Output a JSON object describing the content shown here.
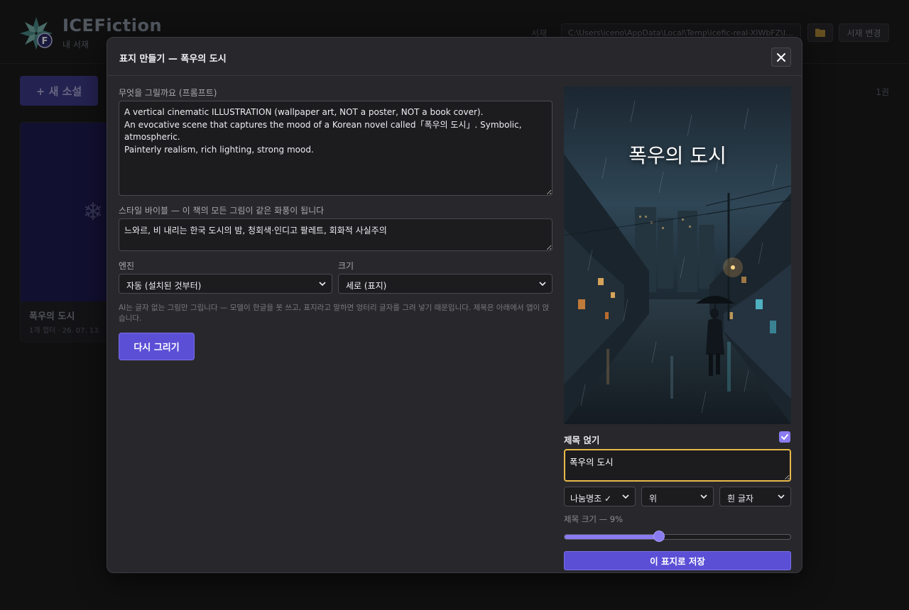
{
  "app": {
    "title": "ICEFiction",
    "subtitle": "내 서재",
    "library_label": "서재",
    "library_path": "C:\\Users\\iceno\\AppData\\Local\\Temp\\icefic-real-XIWbFZ\\IC...",
    "change_library_label": "서재 변경",
    "new_novel_label": "+ 새 소설",
    "book_count": "1권"
  },
  "book": {
    "title": "폭우의 도시",
    "meta": "1개 챕터 · 26. 07. 13."
  },
  "modal": {
    "title": "표지 만들기 — 폭우의 도시",
    "prompt_label": "무엇을 그릴까요 (프롬프트)",
    "prompt_value": "A vertical cinematic ILLUSTRATION (wallpaper art, NOT a poster, NOT a book cover).\nAn evocative scene that captures the mood of a Korean novel called「폭우의 도시」. Symbolic, atmospheric.\nPainterly realism, rich lighting, strong mood.",
    "style_label": "스타일 바이블 — 이 책의 모든 그림이 같은 화풍이 됩니다",
    "style_value": "느와르, 비 내리는 한국 도시의 밤, 청회색·인디고 팔레트, 회화적 사실주의",
    "engine_label": "엔진",
    "engine_value": "자동 (설치된 것부터)",
    "size_label": "크기",
    "size_value": "세로 (표지)",
    "note": "AI는 글자 없는 그림만 그립니다 — 모델이 한글을 못 쓰고, 표지라고 말하면 엉터리 글자를 그려 넣기 때문입니다. 제목은 아래에서 앱이 얹습니다.",
    "redraw_label": "다시 그리기",
    "preview_title": "폭우의 도시",
    "title_on_label": "제목 얹기",
    "title_on_checked": true,
    "title_input_value": "폭우의 도시",
    "font_select": "나눔명조 ✓",
    "position_select": "위",
    "color_select": "흰 글자",
    "title_size_label": "제목 크기 — 9%",
    "title_size_value": 0.42,
    "save_label": "이 표지로 저장"
  },
  "colors": {
    "accent": "#5b4fd6",
    "checkbox": "#8a7cf0",
    "focus_border": "#e8b94a",
    "modal_bg": "#28282c",
    "page_bg": "#1c1c1e"
  }
}
